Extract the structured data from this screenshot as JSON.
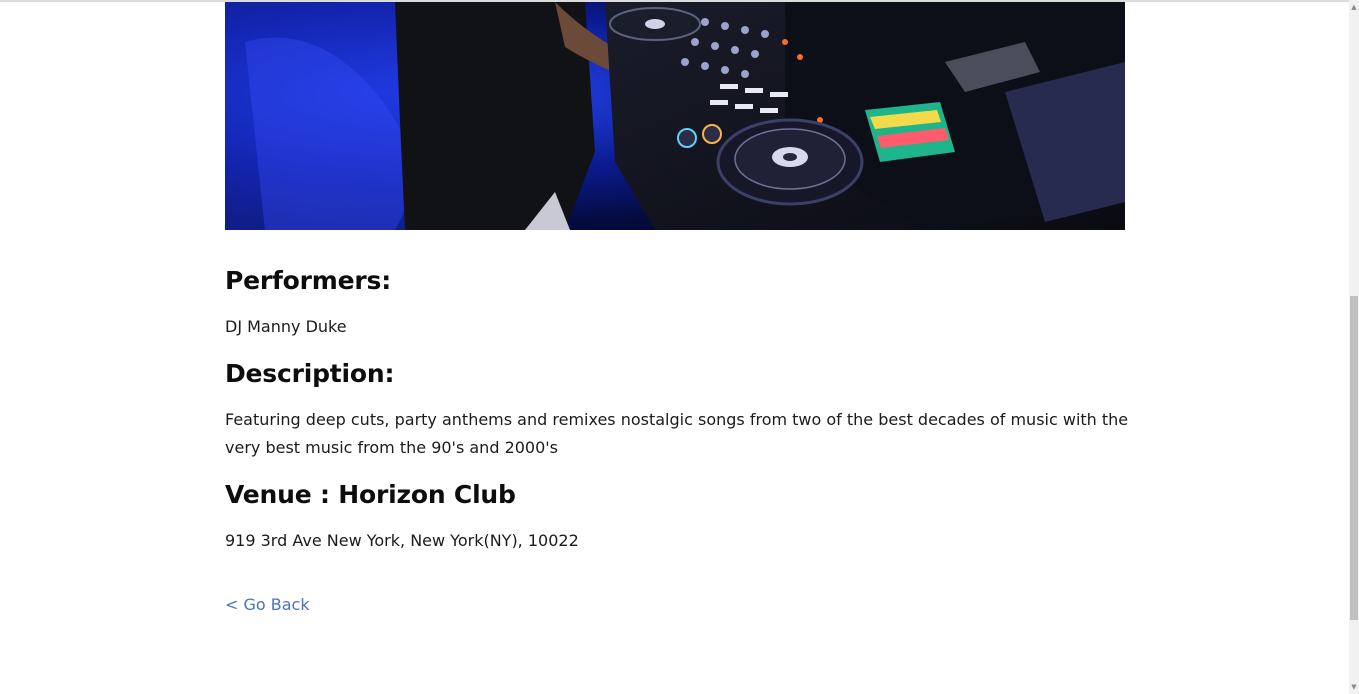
{
  "event": {
    "hero_alt": "DJ performing at mixing console",
    "performers_heading": "Performers:",
    "performers": "DJ Manny Duke",
    "description_heading": "Description:",
    "description": "Featuring deep cuts, party anthems and remixes nostalgic songs from two of the best decades of music with the very best music from the 90's and 2000's",
    "venue_heading": "Venue : Horizon Club",
    "venue_address": "919 3rd Ave New York, New York(NY), 10022",
    "go_back_label": "< Go Back"
  },
  "colors": {
    "link": "#4a74b8",
    "heading": "#0d0d0d"
  }
}
